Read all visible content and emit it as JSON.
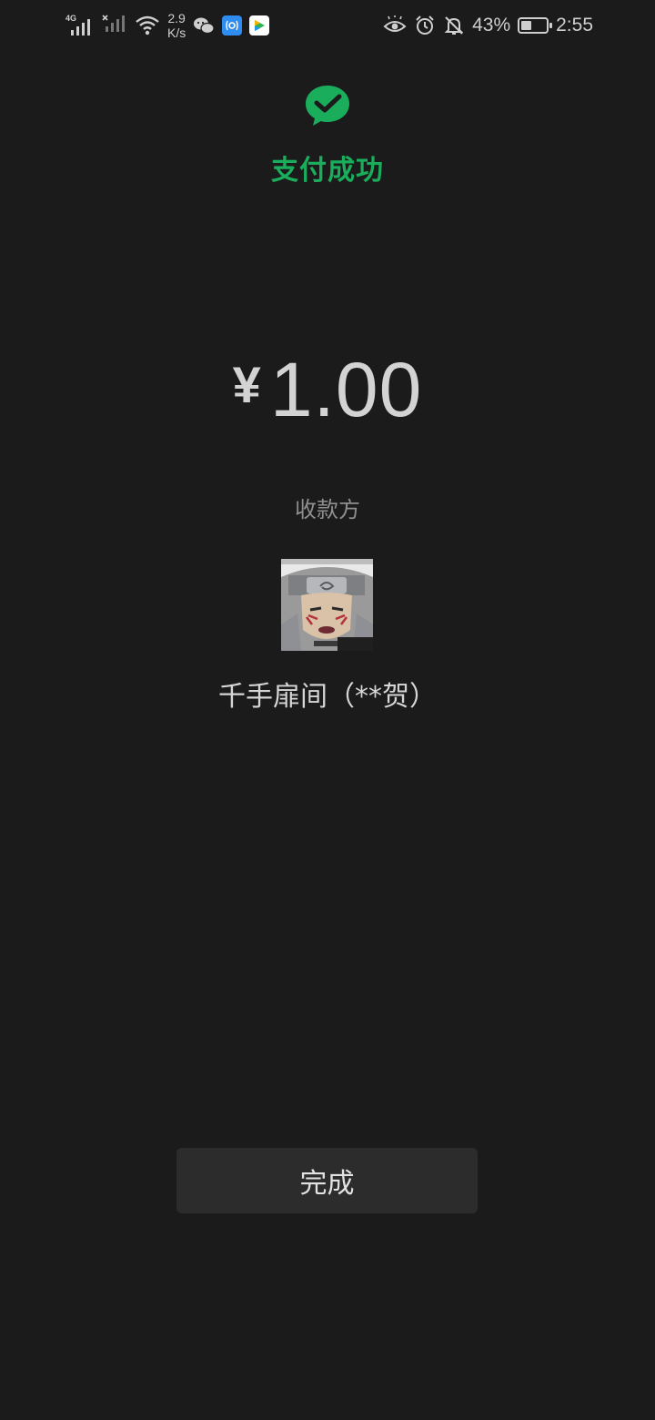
{
  "status_bar": {
    "network_1": "4G",
    "speed_value": "2.9",
    "speed_unit": "K/s",
    "battery_percent": "43%",
    "battery_level": 0.43,
    "time": "2:55",
    "icons_left": [
      "signal-4g-icon",
      "signal-no-sim-icon",
      "wifi-icon",
      "wechat-icon",
      "app-blue-icon",
      "video-player-icon"
    ],
    "icons_right": [
      "eye-comfort-icon",
      "alarm-icon",
      "mute-bell-icon",
      "battery-icon"
    ]
  },
  "header": {
    "logo": "wechat-pay-check-icon",
    "title": "支付成功",
    "accent_color": "#1aad5b"
  },
  "payment": {
    "currency": "¥",
    "amount": "1.00"
  },
  "payee": {
    "label": "收款方",
    "avatar": "payee-avatar-image",
    "name": "千手扉间（**贺）"
  },
  "actions": {
    "done_label": "完成"
  }
}
